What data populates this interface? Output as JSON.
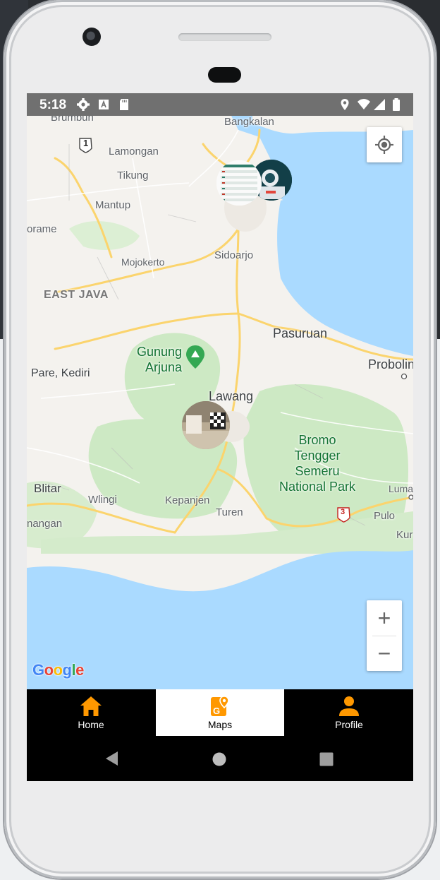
{
  "status_bar": {
    "time": "5:18"
  },
  "map": {
    "labels": {
      "bangkalan": "Bangkalan",
      "brumbun": "Brumbun",
      "lamongan": "Lamongan",
      "tikung": "Tikung",
      "mantup": "Mantup",
      "prame": "orame",
      "sidoarjo": "Sidoarjo",
      "mojokerto": "Mojokerto",
      "east_java": "EAST JAVA",
      "pasuruan": "Pasuruan",
      "probolinggo": "Probolin",
      "gunung_arjuna_1": "Gunung",
      "gunung_arjuna_2": "Arjuna",
      "pare_kediri": "Pare, Kediri",
      "lawang": "Lawang",
      "bromo_1": "Bromo",
      "bromo_2": "Tengger",
      "bromo_3": "Semeru",
      "bromo_4": "National Park",
      "blitar": "Blitar",
      "wlingi": "Wlingi",
      "kepanjen": "Kepanjen",
      "turen": "Turen",
      "lumajang": "Luma",
      "pulo": "Pulo",
      "kur": "Kur",
      "nangan": "nangan",
      "road_1": "1",
      "road_3": "3"
    },
    "zoom_in": "+",
    "zoom_out": "−",
    "attribution": {
      "g1": "G",
      "o1": "o",
      "o2": "o",
      "g2": "g",
      "l": "l",
      "e": "e"
    },
    "colors": {
      "land": "#f4f2ee",
      "water": "#aadaff",
      "park": "#c8e6c0",
      "road": "#fbd46d"
    }
  },
  "bottom_nav": {
    "items": [
      {
        "label": "Home",
        "icon": "home-icon",
        "active": false
      },
      {
        "label": "Maps",
        "icon": "map-pin-icon",
        "active": true
      },
      {
        "label": "Profile",
        "icon": "person-icon",
        "active": false
      }
    ],
    "accent": "#ff9800"
  }
}
